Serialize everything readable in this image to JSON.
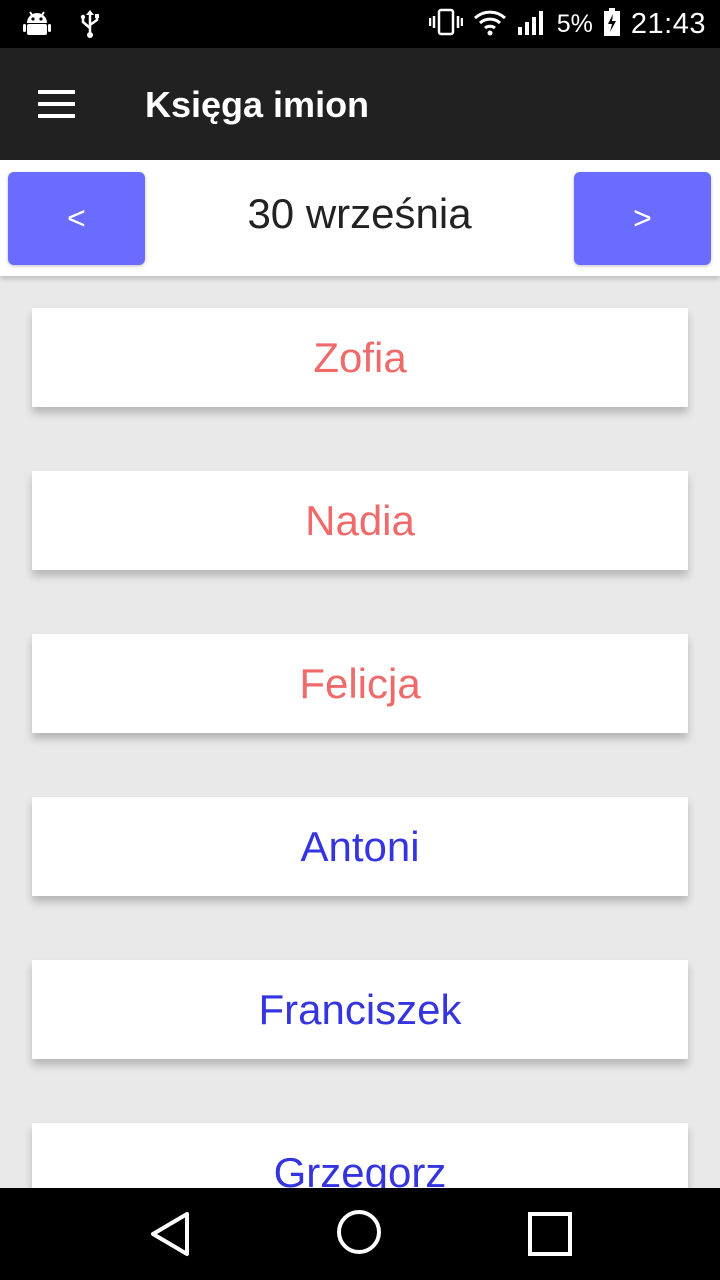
{
  "status": {
    "battery_pct": "5%",
    "time": "21:43",
    "icons": [
      "android-icon",
      "usb-icon",
      "vibrate-icon",
      "wifi-icon",
      "signal-icon",
      "battery-charging-icon"
    ]
  },
  "appbar": {
    "title": "Księga imion"
  },
  "datebar": {
    "prev_label": "<",
    "date": "30 września",
    "next_label": ">"
  },
  "names": [
    {
      "label": "Zofia",
      "gender": "female"
    },
    {
      "label": "Nadia",
      "gender": "female"
    },
    {
      "label": "Felicja",
      "gender": "female"
    },
    {
      "label": "Antoni",
      "gender": "male"
    },
    {
      "label": "Franciszek",
      "gender": "male"
    },
    {
      "label": "Grzegorz",
      "gender": "male"
    }
  ],
  "colors": {
    "accent": "#6a6cff",
    "female": "#ef6a6a",
    "male": "#3535e0",
    "appbar": "#212121"
  }
}
